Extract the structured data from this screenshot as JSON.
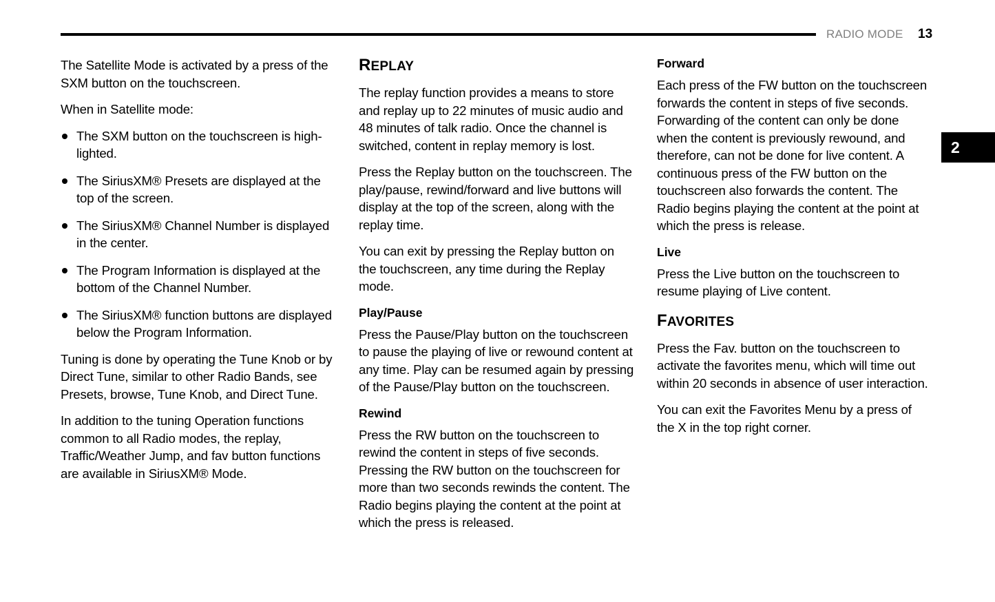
{
  "header": {
    "chapter_label": "RADIO MODE",
    "page_number": "13",
    "rule_color": "#000000",
    "chapter_label_color": "#808080"
  },
  "chapter_tab": {
    "number": "2",
    "background_color": "#000000",
    "text_color": "#ffffff"
  },
  "columns": {
    "column_1": {
      "intro_paragraph": "The Satellite Mode is activated by a press of the SXM button on the touchscreen.",
      "list_lead_in": "When in Satellite mode:",
      "bullets": [
        "The SXM button on the touchscreen is high-lighted.",
        "The SiriusXM® Presets are displayed at the top of the screen.",
        "The SiriusXM® Channel Number is displayed in the center.",
        "The Program Information is displayed at the bottom of the Channel Number.",
        "The SiriusXM® function buttons are displayed below the Program Information."
      ],
      "tuning_paragraph": "Tuning is done by operating the Tune Knob or by Direct Tune, similar to other Radio Bands, see Presets, browse, Tune Knob, and Direct Tune.",
      "addition_paragraph": "In addition to the tuning Operation functions common to all Radio modes, the replay, Traffic/Weather Jump, and fav button functions are available in SiriusXM® Mode."
    },
    "column_2": {
      "heading": {
        "initial": "R",
        "rest": "EPLAY",
        "full": "REPLAY"
      },
      "paragraph_1": "The replay function provides a means to store and replay up to 22 minutes of music audio and 48 minutes of talk radio. Once the channel is switched, content in replay memory is lost.",
      "paragraph_2": "Press the Replay button on the touchscreen. The play/pause, rewind/forward and live buttons will display at the top of the screen, along with the replay time.",
      "paragraph_3": "You can exit by pressing the Replay button on the touchscreen, any time during the Replay mode.",
      "subheading_play_pause": "Play/Pause",
      "paragraph_play_pause": "Press the Pause/Play button on the touchscreen to pause the playing of live or rewound content at any time. Play can be resumed again by pressing of the Pause/Play button on the touchscreen.",
      "subheading_rewind": "Rewind",
      "paragraph_rewind": "Press the RW button on the touchscreen to rewind the content in steps of five seconds. Pressing the RW button on the touchscreen for more than two seconds rewinds the content. The Radio begins playing the content at the point at which the press is released."
    },
    "column_3": {
      "subheading_forward": "Forward",
      "paragraph_forward": "Each press of the FW button on the touchscreen forwards the content in steps of five seconds. Forwarding of the content can only be done when the content is previously rewound, and therefore, can not be done for live content. A continuous press of the FW button on the touchscreen also forwards the content. The Radio begins playing the content at the point at which the press is release.",
      "subheading_live": "Live",
      "paragraph_live": "Press the Live button on the touchscreen to resume playing of Live content.",
      "heading_favorites": {
        "initial": "F",
        "rest": "AVORITES",
        "full": "FAVORITES"
      },
      "paragraph_favorites_1": "Press the Fav. button on the touchscreen to activate the favorites menu, which will time out within 20 seconds in absence of user interaction.",
      "paragraph_favorites_2": "You can exit the Favorites Menu by a press of the X in the top right corner."
    }
  }
}
